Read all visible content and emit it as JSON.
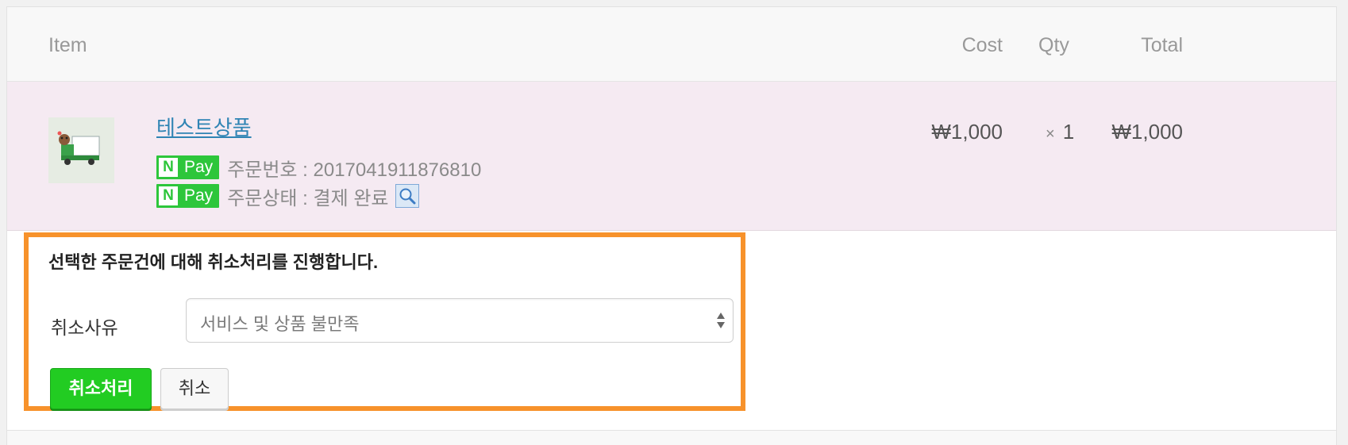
{
  "table": {
    "headers": {
      "item": "Item",
      "cost": "Cost",
      "qty": "Qty",
      "total": "Total"
    }
  },
  "order_item": {
    "name": "테스트상품",
    "cost": "₩1,000",
    "qty_symbol": "×",
    "qty": "1",
    "total": "₩1,000",
    "npay_n": "N",
    "npay_label": "Pay",
    "order_number": "주문번호 : 2017041911876810",
    "order_status": "주문상태 : 결제 완료"
  },
  "cancel_panel": {
    "title": "선택한 주문건에 대해 취소처리를 진행합니다.",
    "reason_label": "취소사유",
    "reason_selected": "서비스 및 상품 불만족",
    "confirm_label": "취소처리",
    "cancel_label": "취소"
  },
  "colors": {
    "highlight_border": "#f7922b",
    "npay_green": "#2dc63b",
    "primary_button": "#22cc22",
    "row_background": "#f5eaf2",
    "link": "#2f84b4"
  }
}
